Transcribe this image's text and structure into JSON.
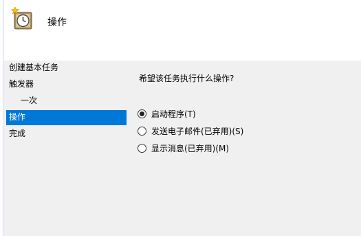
{
  "header": {
    "title": "操作",
    "icon": "task-clock-icon"
  },
  "steps": [
    {
      "label": "创建基本任务",
      "indent": false,
      "active": false
    },
    {
      "label": "触发器",
      "indent": false,
      "active": false
    },
    {
      "label": "一次",
      "indent": true,
      "active": false
    },
    {
      "label": "操作",
      "indent": false,
      "active": true
    },
    {
      "label": "完成",
      "indent": false,
      "active": false
    }
  ],
  "main": {
    "question": "希望该任务执行什么操作?",
    "options": [
      {
        "label": "启动程序(T)",
        "selected": true
      },
      {
        "label": "发送电子邮件(已弃用)(S)",
        "selected": false
      },
      {
        "label": "显示消息(已弃用)(M)",
        "selected": false
      }
    ]
  },
  "colors": {
    "accent": "#0078d7",
    "panel": "#f0f0f0"
  }
}
